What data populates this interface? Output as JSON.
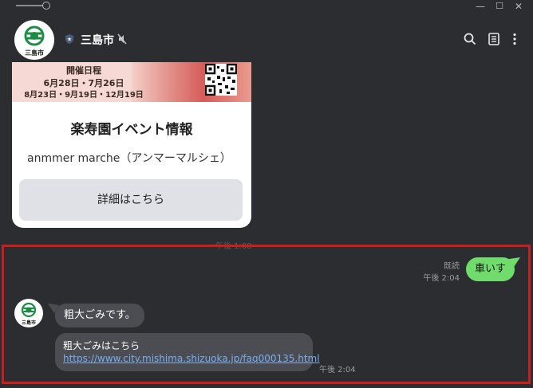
{
  "window": {
    "minimize_glyph": "—",
    "maximize_glyph": "☐",
    "close_glyph": "✕"
  },
  "header": {
    "room_name": "三島市",
    "avatar_caption": "三島市",
    "icons": [
      "shield-icon",
      "mute-icon",
      "search-icon",
      "notes-icon",
      "more-icon"
    ]
  },
  "card": {
    "banner_heading": "開催日程",
    "banner_dates_line1": "6月28日・7月26日",
    "banner_dates_line2": "8月23日・9月19日・12月19日",
    "title": "楽寿園イベント情報",
    "subtitle": "anmmer marche（アンマーマルシェ）",
    "button_label": "詳細はこちら"
  },
  "faded_time": "午後 1:08",
  "messages": {
    "outgoing": {
      "read_label": "既読",
      "time": "午後 2:04",
      "text": "車いす"
    },
    "incoming": {
      "avatar_caption": "三島市",
      "text1": "粗大ごみです。",
      "text2": "粗大ごみはこちら",
      "link": "https://www.city.mishima.shizuoka.jp/faq000135.html",
      "time": "午後 2:04"
    }
  },
  "colors": {
    "background": "#2c2d30",
    "bubble_out": "#6fdc6c",
    "bubble_in": "#4b4d52",
    "highlight": "#c81e1e",
    "link": "#7aaef0"
  }
}
